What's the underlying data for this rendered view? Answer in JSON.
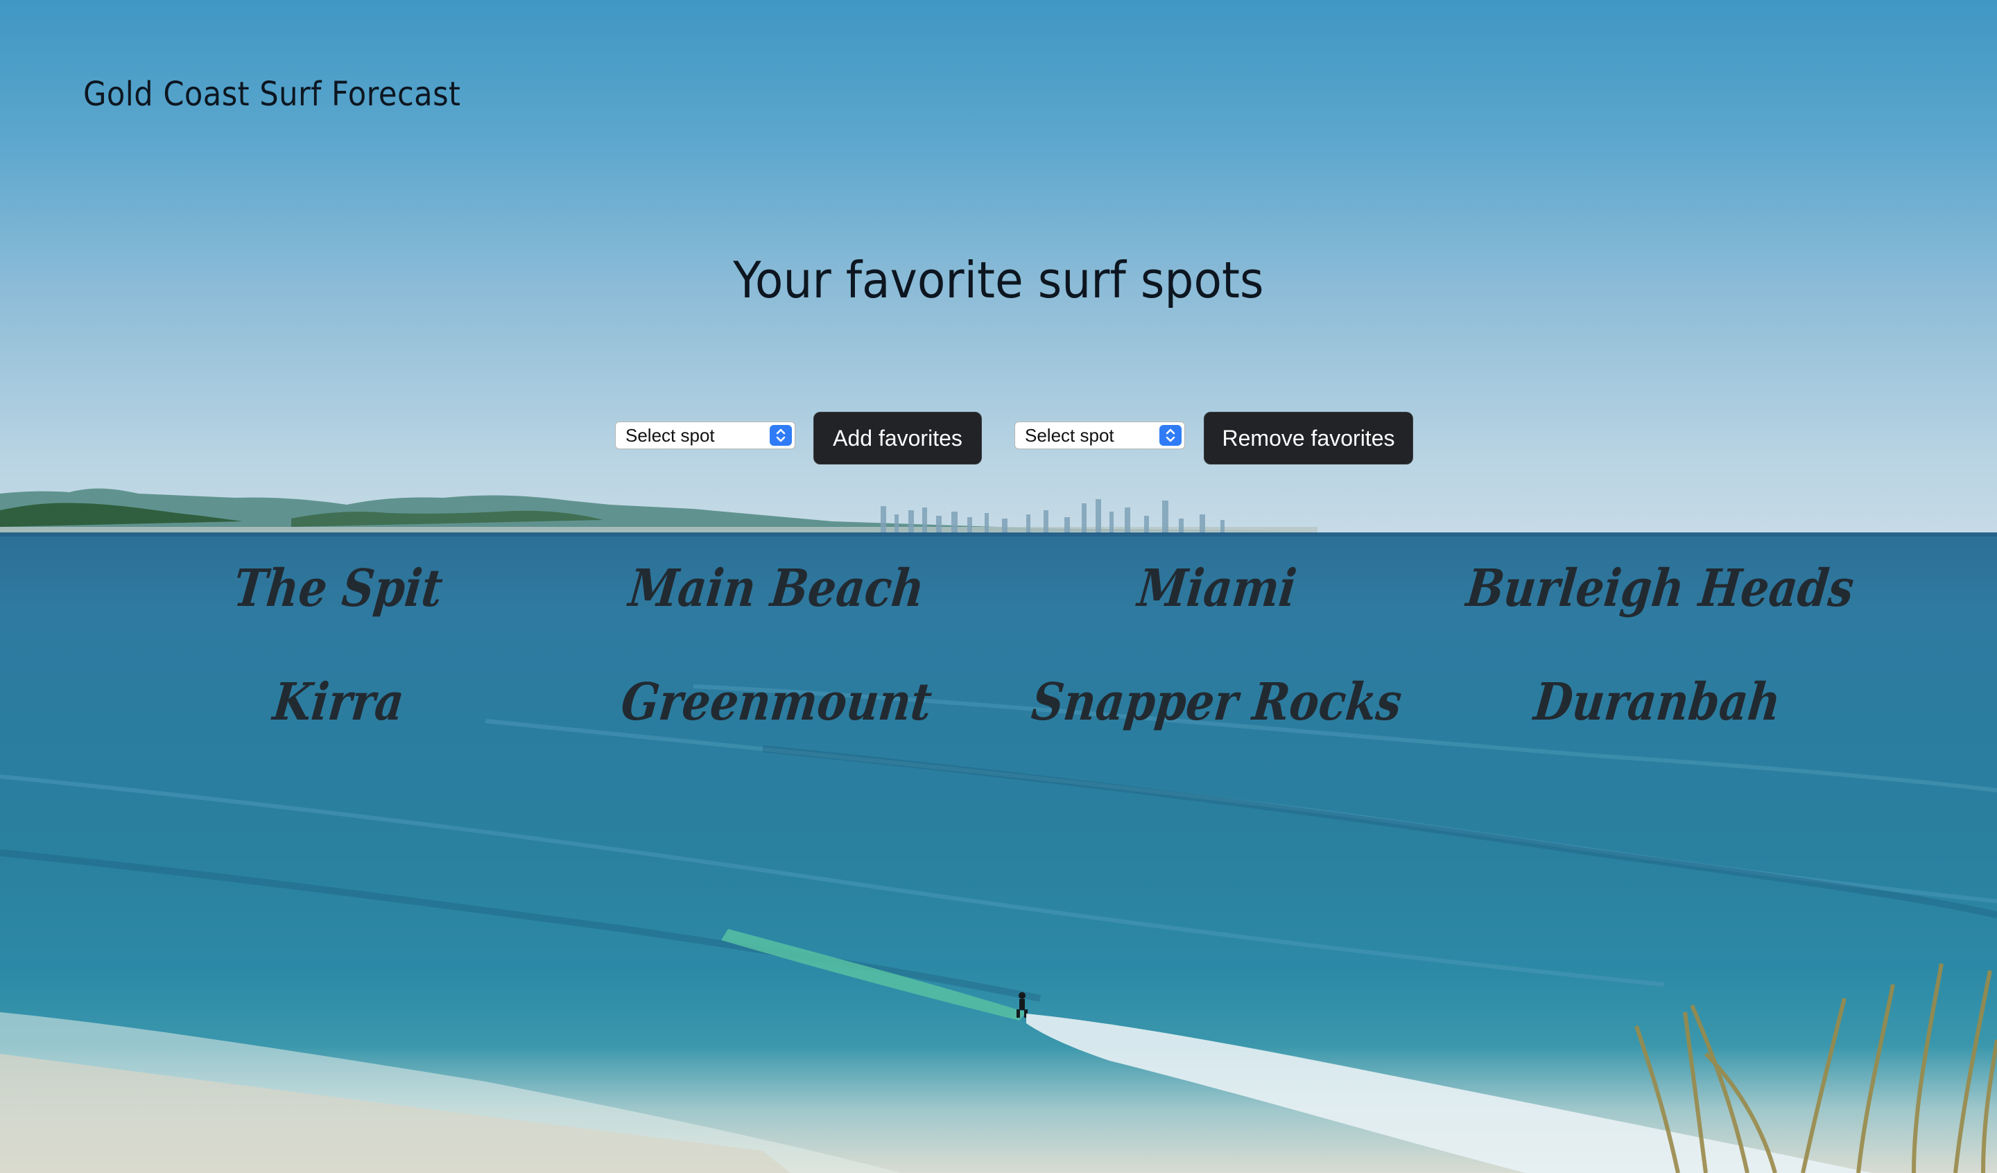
{
  "brand": {
    "title": "Gold Coast Surf Forecast"
  },
  "main": {
    "heading": "Your favorite surf spots"
  },
  "controls": {
    "add_select": {
      "value": "Select spot"
    },
    "add_button": "Add favorites",
    "remove_select": {
      "value": "Select spot"
    },
    "remove_button": "Remove favorites"
  },
  "spots": [
    {
      "name": "The Spit"
    },
    {
      "name": "Main Beach"
    },
    {
      "name": "Miami"
    },
    {
      "name": "Burleigh Heads"
    },
    {
      "name": "Kirra"
    },
    {
      "name": "Greenmount"
    },
    {
      "name": "Snapper Rocks"
    },
    {
      "name": "Duranbah"
    }
  ],
  "background": {
    "description_icon": "beach-photo",
    "sky_color": "#5ba6cd",
    "ocean_color": "#2b7d9f",
    "button_color": "#212327",
    "select_arrow_color": "#2f7cf6"
  }
}
